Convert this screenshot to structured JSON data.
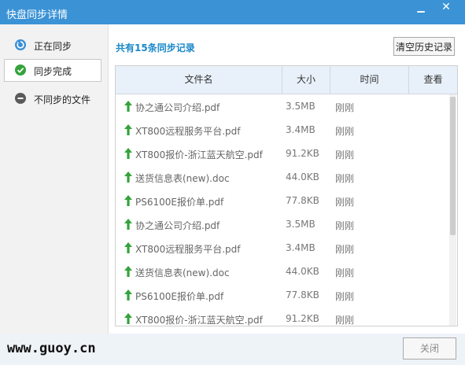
{
  "window": {
    "title": "快盘同步详情"
  },
  "sidebar": {
    "items": [
      {
        "label": "正在同步",
        "icon": "sync-icon",
        "color": "#3a8fd7",
        "active": false
      },
      {
        "label": "同步完成",
        "icon": "check-icon",
        "color": "#34a33b",
        "active": true
      },
      {
        "label": "不同步的文件",
        "icon": "minus-icon",
        "color": "#5a5a5a",
        "active": false
      }
    ]
  },
  "main": {
    "summary": "共有15条同步记录",
    "clear_button": "清空历史记录",
    "table": {
      "headers": [
        "文件名",
        "大小",
        "时间",
        "查看"
      ],
      "rows": [
        {
          "name": "协之通公司介绍.pdf",
          "size": "3.5MB",
          "time": "刚刚"
        },
        {
          "name": "XT800远程服务平台.pdf",
          "size": "3.4MB",
          "time": "刚刚"
        },
        {
          "name": "XT800报价-浙江蓝天航空.pdf",
          "size": "91.2KB",
          "time": "刚刚"
        },
        {
          "name": "送货信息表(new).doc",
          "size": "44.0KB",
          "time": "刚刚"
        },
        {
          "name": "PS6100E报价单.pdf",
          "size": "77.8KB",
          "time": "刚刚"
        },
        {
          "name": "协之通公司介绍.pdf",
          "size": "3.5MB",
          "time": "刚刚"
        },
        {
          "name": "XT800远程服务平台.pdf",
          "size": "3.4MB",
          "time": "刚刚"
        },
        {
          "name": "送货信息表(new).doc",
          "size": "44.0KB",
          "time": "刚刚"
        },
        {
          "name": "PS6100E报价单.pdf",
          "size": "77.8KB",
          "time": "刚刚"
        },
        {
          "name": "XT800报价-浙江蓝天航空.pdf",
          "size": "91.2KB",
          "time": "刚刚"
        }
      ]
    }
  },
  "footer": {
    "watermark": "www.guoy.cn",
    "close_button": "关闭"
  },
  "colors": {
    "titlebar": "#3b93d6",
    "accent": "#1a87c8",
    "upload_arrow": "#34a33b"
  }
}
